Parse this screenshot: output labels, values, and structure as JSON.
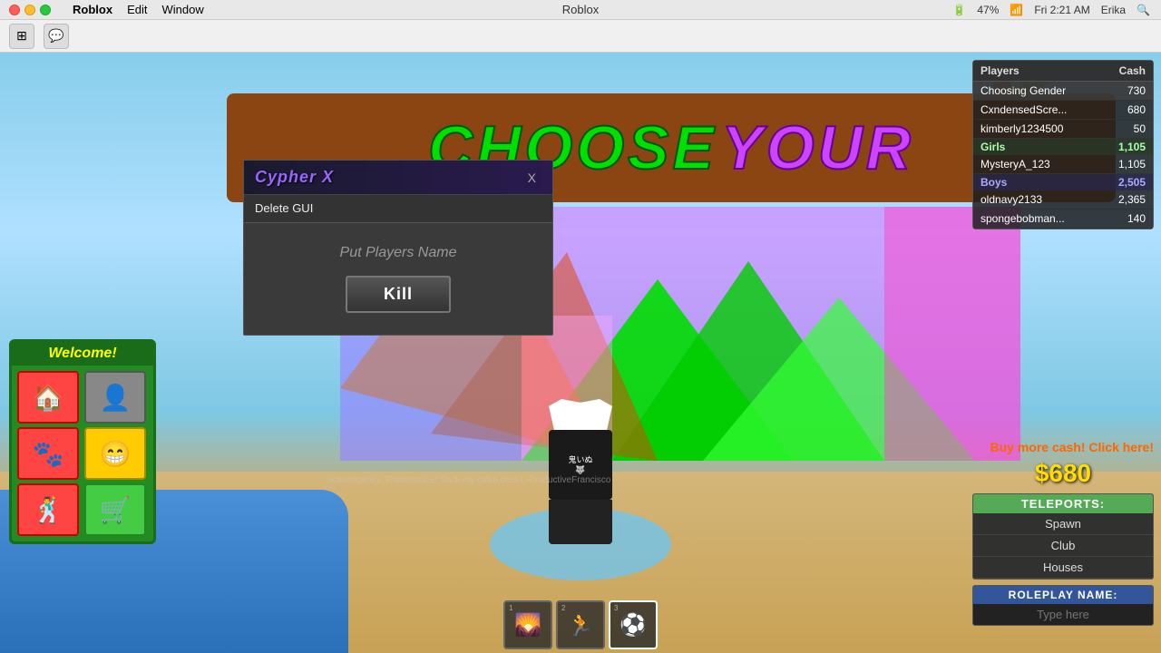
{
  "titlebar": {
    "app_name": "Roblox",
    "window_title": "Roblox",
    "menu_items": [
      "Roblox",
      "Edit",
      "Window"
    ],
    "time": "Fri 2:21 AM",
    "user": "Erika",
    "battery": "47%"
  },
  "cypher_gui": {
    "title": "Cypher X",
    "close_label": "X",
    "menu_item": "Delete GUI",
    "player_name_placeholder": "Put Players Name",
    "kill_button_label": "Kill"
  },
  "welcome_panel": {
    "title": "Welcome!",
    "buttons": [
      {
        "icon": "🏠",
        "style": "red",
        "name": "home"
      },
      {
        "icon": "👤",
        "style": "gray",
        "name": "player"
      },
      {
        "icon": "🐾",
        "style": "red",
        "name": "pets"
      },
      {
        "icon": "😁",
        "style": "yellow",
        "name": "emoji"
      },
      {
        "icon": "🕺",
        "style": "red",
        "name": "dance"
      },
      {
        "icon": "🛒",
        "style": "green",
        "name": "shop"
      }
    ]
  },
  "right_panel": {
    "col1": "Players",
    "col2": "Cash",
    "rows": [
      {
        "name": "Choosing Gender",
        "cash": "730",
        "highlight": false,
        "type": "normal"
      },
      {
        "name": "CxndensedScre...",
        "cash": "680",
        "highlight": true,
        "type": "normal"
      },
      {
        "name": "kimberly1234500",
        "cash": "50",
        "highlight": false,
        "type": "normal"
      },
      {
        "name": "Girls",
        "cash": "1,105",
        "highlight": false,
        "type": "section_green"
      },
      {
        "name": "MysteryA_123",
        "cash": "1,105",
        "highlight": false,
        "type": "normal"
      },
      {
        "name": "Boys",
        "cash": "2,505",
        "highlight": false,
        "type": "section_blue"
      },
      {
        "name": "oldnavy2133",
        "cash": "2,365",
        "highlight": false,
        "type": "normal"
      },
      {
        "name": "spongebobman...",
        "cash": "140",
        "highlight": false,
        "type": "normal"
      }
    ]
  },
  "cash_panel": {
    "buy_cash_label": "Buy more cash! Click here!",
    "cash_display": "$680",
    "teleports_header": "TELEPORTS:",
    "teleport_buttons": [
      "Spawn",
      "Club",
      "Houses"
    ],
    "roleplay_header": "ROLEPLAY NAME:",
    "roleplay_placeholder": "Type here"
  },
  "hotbar": {
    "slots": [
      {
        "num": "1",
        "active": false
      },
      {
        "num": "2",
        "active": false
      },
      {
        "num": "3",
        "active": true
      }
    ]
  },
  "banner": {
    "choose": "CHOOSE",
    "your": "YOUR"
  },
  "watermark": "ScavengerBy: FranciscoLet Sack my clitko ores L-ProductiveFrancisco"
}
